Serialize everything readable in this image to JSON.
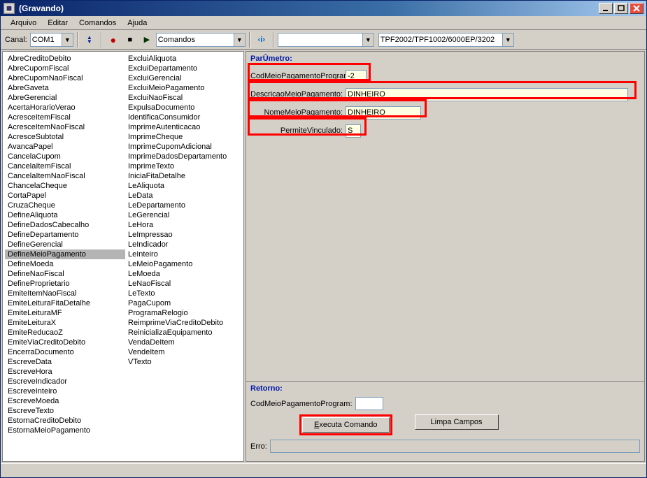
{
  "window": {
    "title": "(Gravando)"
  },
  "menu": {
    "arquivo": "Arquivo",
    "editar": "Editar",
    "comandos": "Comandos",
    "ajuda": "Ajuda"
  },
  "toolbar": {
    "canal_label": "Canal:",
    "canal_value": "COM1",
    "combo_comandos": "Comandos",
    "combo_blank": "",
    "combo_tpf": "TPF2002/TPF1002/6000EP/3202"
  },
  "commands": {
    "col1": [
      "AbreCreditoDebito",
      "AbreCupomFiscal",
      "AbreCupomNaoFiscal",
      "AbreGaveta",
      "AbreGerencial",
      "AcertaHorarioVerao",
      "AcresceItemFiscal",
      "AcresceItemNaoFiscal",
      "AcresceSubtotal",
      "AvancaPapel",
      "CancelaCupom",
      "CancelaItemFiscal",
      "CancelaItemNaoFiscal",
      "ChancelaCheque",
      "CortaPapel",
      "CruzaCheque",
      "DefineAliquota",
      "DefineDadosCabecalho",
      "DefineDepartamento",
      "DefineGerencial",
      "DefineMeioPagamento",
      "DefineMoeda",
      "DefineNaoFiscal",
      "DefineProprietario",
      "EmiteItemNaoFiscal",
      "EmiteLeituraFitaDetalhe",
      "EmiteLeituraMF",
      "EmiteLeituraX",
      "EmiteReducaoZ",
      "EmiteViaCreditoDebito",
      "EncerraDocumento",
      "EscreveData",
      "EscreveHora",
      "EscreveIndicador",
      "EscreveInteiro",
      "EscreveMoeda",
      "EscreveTexto",
      "EstornaCreditoDebito",
      "EstornaMeioPagamento"
    ],
    "col2": [
      "ExcluiAliquota",
      "ExcluiDepartamento",
      "ExcluiGerencial",
      "ExcluiMeioPagamento",
      "ExcluiNaoFiscal",
      "ExpulsaDocumento",
      "IdentificaConsumidor",
      "ImprimeAutenticacao",
      "ImprimeCheque",
      "ImprimeCupomAdicional",
      "ImprimeDadosDepartamento",
      "ImprimeTexto",
      "IniciaFitaDetalhe",
      "LeAliquota",
      "LeData",
      "LeDepartamento",
      "LeGerencial",
      "LeHora",
      "LeImpressao",
      "LeIndicador",
      "LeInteiro",
      "LeMeioPagamento",
      "LeMoeda",
      "LeNaoFiscal",
      "LeTexto",
      "PagaCupom",
      "ProgramaRelogio",
      "ReimprimeViaCreditoDebito",
      "ReinicializaEquipamento",
      "VendaDeItem",
      "VendeItem",
      "VTexto"
    ],
    "selected": "DefineMeioPagamento"
  },
  "params": {
    "section": "ParÛmetro:",
    "p1": {
      "label": "CodMeioPagamentoProgram:",
      "value": "-2"
    },
    "p2": {
      "label": "DescricaoMeioPagamento:",
      "value": "DINHEIRO"
    },
    "p3": {
      "label": "NomeMeioPagamento:",
      "value": "DINHEIRO"
    },
    "p4": {
      "label": "PermiteVinculado:",
      "value": "S"
    }
  },
  "retorno": {
    "section": "Retorno:",
    "label1": "CodMeioPagamentoProgram:",
    "value1": "",
    "btn_exec": "Executa Comando",
    "btn_exec_underline": "E",
    "btn_limpa": "Limpa Campos",
    "erro_label": "Erro:",
    "erro_value": ""
  }
}
